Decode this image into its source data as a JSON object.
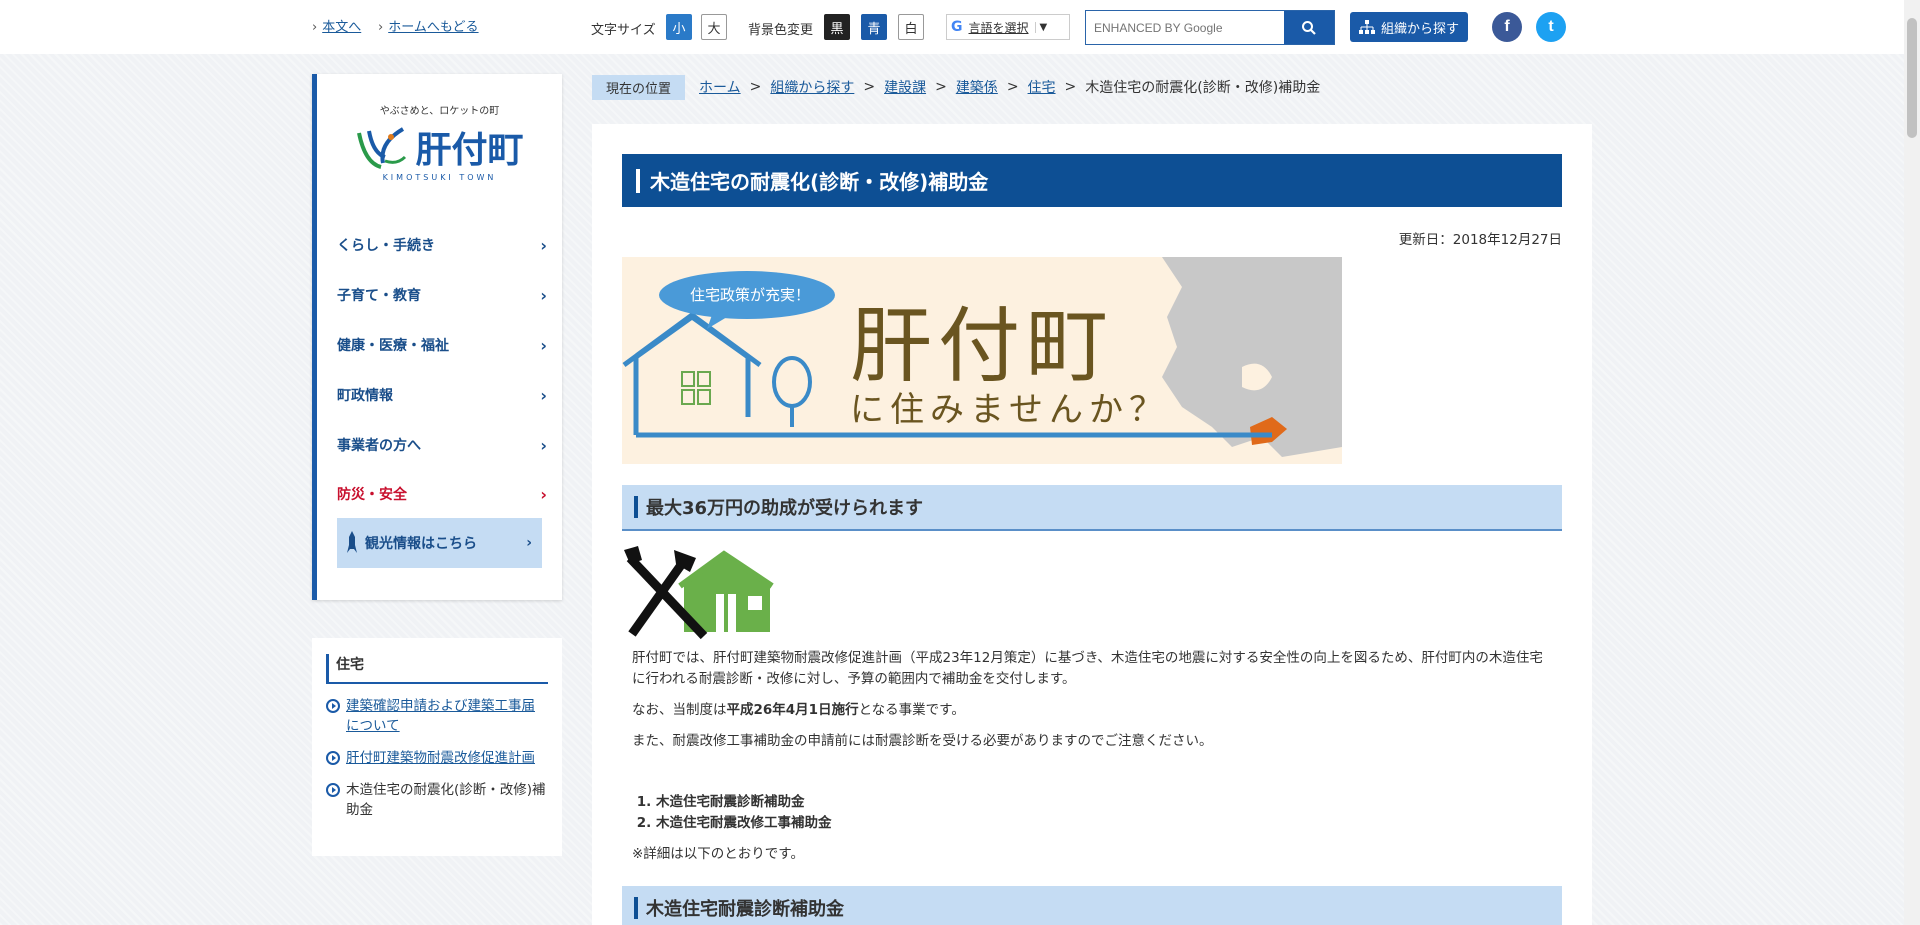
{
  "header": {
    "skip_main": "本文へ",
    "skip_home": "ホームへもどる",
    "font_size_label": "文字サイズ",
    "font_small": "小",
    "font_large": "大",
    "bg_label": "背景色変更",
    "bg_black": "黒",
    "bg_blue": "青",
    "bg_white": "白",
    "translate_label": "言語を選択",
    "translate_arrow": "▼",
    "search_placeholder": "ENHANCED BY Google",
    "org_button": "組織から探す",
    "facebook": "f",
    "twitter": "t"
  },
  "logo": {
    "tagline": "やぶさめと、ロケットの町",
    "name": "肝付町",
    "subtitle": "KIMOTSUKI TOWN"
  },
  "nav": {
    "items": [
      {
        "label": "くらし・手続き"
      },
      {
        "label": "子育て・教育"
      },
      {
        "label": "健康・医療・福祉"
      },
      {
        "label": "町政情報"
      },
      {
        "label": "事業者の方へ"
      },
      {
        "label": "防災・安全"
      }
    ],
    "tourism": "観光情報はこちら"
  },
  "subnav": {
    "title": "住宅",
    "items": [
      {
        "label": "建築確認申請および建築工事届について"
      },
      {
        "label": "肝付町建築物耐震改修促進計画"
      },
      {
        "label": "木造住宅の耐震化(診断・改修)補助金"
      }
    ]
  },
  "breadcrumb": {
    "here": "現在の位置",
    "items": [
      "ホーム",
      "組織から探す",
      "建設課",
      "建築係",
      "住宅"
    ],
    "current": "木造住宅の耐震化(診断・改修)補助金",
    "separator": ">"
  },
  "page": {
    "title": "木造住宅の耐震化(診断・改修)補助金",
    "updated": "更新日：2018年12月27日",
    "banner": {
      "bubble": "住宅政策が充実！",
      "line1": "肝付町",
      "line2": "に住みませんか？"
    },
    "section1": "最大36万円の助成が受けられます",
    "para1": "肝付町では、肝付町建築物耐震改修促進計画（平成23年12月策定）に基づき、木造住宅の地震に対する安全性の向上を図るため、肝付町内の木造住宅に行われる耐震診断・改修に対し、予算の範囲内で補助金を交付します。",
    "para2_pre": "なお、当制度は",
    "para2_bold": "平成26年4月1日施行",
    "para2_post": "となる事業です。",
    "para3": "また、耐震改修工事補助金の申請前には耐震診断を受ける必要がありますのでご注意ください。",
    "list": [
      "木造住宅耐震診断補助金",
      "木造住宅耐震改修工事補助金"
    ],
    "note": "※詳細は以下のとおりです。",
    "section2": "木造住宅耐震診断補助金"
  },
  "colors": {
    "accent": "#1a5aa8",
    "heading_bg": "#0d4f94",
    "subheading_bg": "#c5dcf3",
    "alert_red": "#c8102e"
  }
}
